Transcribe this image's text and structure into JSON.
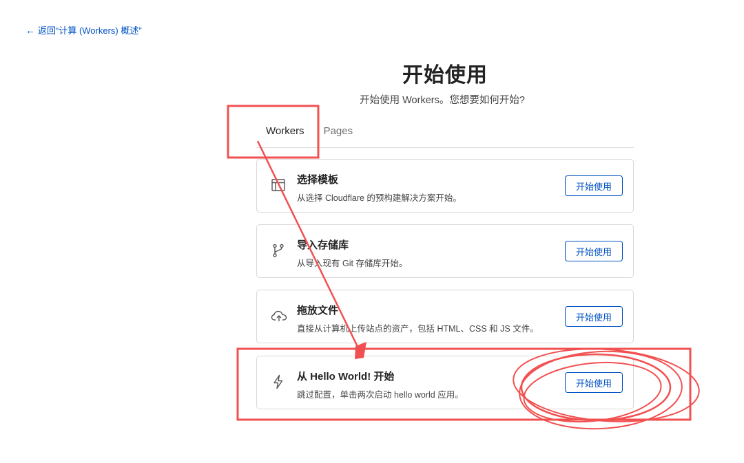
{
  "back_link": {
    "label": "返回“计算 (Workers) 概述”"
  },
  "header": {
    "title": "开始使用",
    "subtitle": "开始使用 Workers。您想要如何开始?"
  },
  "tabs": [
    {
      "label": "Workers",
      "active": true
    },
    {
      "label": "Pages",
      "active": false
    }
  ],
  "cards": [
    {
      "icon": "browser-window-icon",
      "title": "选择模板",
      "description": "从选择 Cloudflare 的预构建解决方案开始。",
      "button": "开始使用"
    },
    {
      "icon": "git-branch-icon",
      "title": "导入存储库",
      "description": "从导入现有 Git 存储库开始。",
      "button": "开始使用"
    },
    {
      "icon": "cloud-upload-icon",
      "title": "拖放文件",
      "description": "直接从计算机上传站点的资产，包括 HTML、CSS 和 JS 文件。",
      "button": "开始使用"
    },
    {
      "icon": "lightning-bolt-icon",
      "title": "从 Hello World! 开始",
      "description": "跳过配置，单击两次启动 hello world 应用。",
      "button": "开始使用"
    }
  ],
  "colors": {
    "accent": "#0051c3",
    "annotation": "#f25050"
  }
}
